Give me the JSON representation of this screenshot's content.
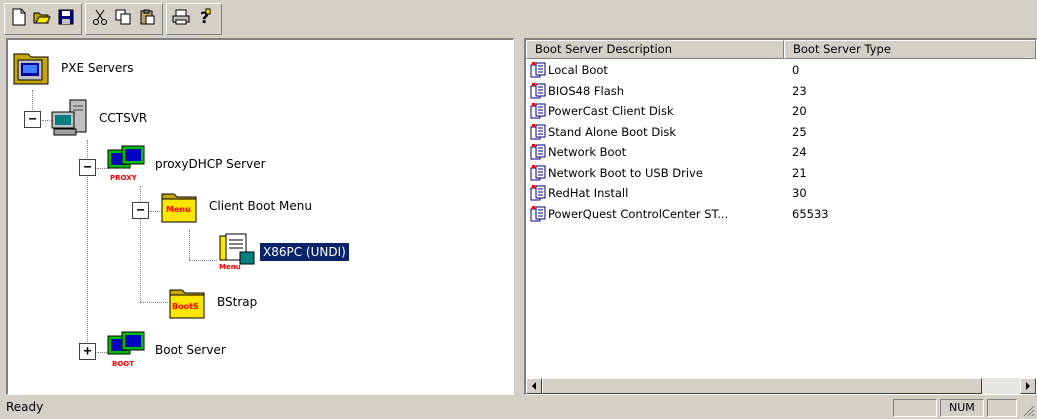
{
  "toolbar": {
    "buttons": [
      {
        "icon": "new-icon"
      },
      {
        "icon": "open-icon"
      },
      {
        "icon": "save-icon"
      },
      {
        "icon": "cut-icon"
      },
      {
        "icon": "copy-icon"
      },
      {
        "icon": "paste-icon"
      },
      {
        "icon": "print-icon"
      },
      {
        "icon": "help-icon"
      }
    ]
  },
  "tree": {
    "root": "PXE Servers",
    "server": "CCTSVR",
    "proxy": "proxyDHCP Server",
    "menu": "Client Boot Menu",
    "selected_item": "X86PC (UNDI)",
    "bstrap": "BStrap",
    "boot_server": "Boot Server",
    "icon_badges": {
      "proxy": "PROXY",
      "menu_folder": "Menu",
      "menu_item": "Menu",
      "bstrap_folder": "BootS",
      "boot": "BOOT"
    }
  },
  "list": {
    "columns": [
      "Boot Server Description",
      "Boot Server Type"
    ],
    "rows": [
      {
        "description": "Local Boot",
        "type": "0"
      },
      {
        "description": "BIOS48 Flash",
        "type": "23"
      },
      {
        "description": "PowerCast Client Disk",
        "type": "20"
      },
      {
        "description": "Stand Alone Boot Disk",
        "type": "25"
      },
      {
        "description": "Network Boot",
        "type": "24"
      },
      {
        "description": "Network Boot to USB Drive",
        "type": "21"
      },
      {
        "description": "RedHat Install",
        "type": "30"
      },
      {
        "description": "PowerQuest ControlCenter ST...",
        "type": "65533"
      }
    ]
  },
  "status": {
    "text": "Ready",
    "num": "NUM"
  },
  "colors": {
    "face": "#d4d0c8",
    "selection": "#0a246a",
    "folder": "#ffe600",
    "badge_red": "#ff0000"
  }
}
